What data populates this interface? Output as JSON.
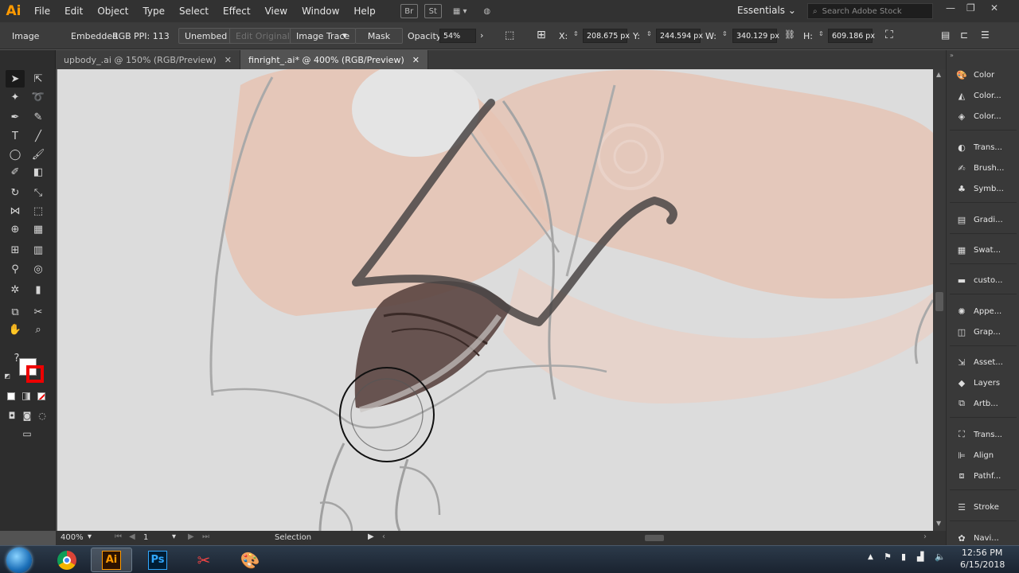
{
  "app": {
    "logo": "Ai",
    "workspace": "Essentials",
    "stock_search_placeholder": "Search Adobe Stock"
  },
  "menu": [
    "File",
    "Edit",
    "Object",
    "Type",
    "Select",
    "Effect",
    "View",
    "Window",
    "Help"
  ],
  "menubar_icons": {
    "bridge": "Br",
    "stock": "St"
  },
  "control": {
    "object_type": "Image",
    "embedded": "Embedded",
    "colormode": "RGB",
    "ppi": "PPI: 113",
    "unembed": "Unembed",
    "edit_original": "Edit Original",
    "image_trace": "Image Trace",
    "mask": "Mask",
    "opacity_label": "Opacity:",
    "opacity_value": "54%",
    "x_label": "X:",
    "x_value": "208.675 px",
    "y_label": "Y:",
    "y_value": "244.594 px",
    "w_label": "W:",
    "w_value": "340.129 px",
    "h_label": "H:",
    "h_value": "609.186 px"
  },
  "tabs": [
    {
      "label": "upbody_.ai @ 150% (RGB/Preview)",
      "active": false
    },
    {
      "label": "finright_.ai* @ 400% (RGB/Preview)",
      "active": true
    }
  ],
  "status": {
    "zoom": "400%",
    "artboard": "1",
    "tool": "Selection"
  },
  "panels": [
    "Color",
    "Color...",
    "Color...",
    "Trans...",
    "Brush...",
    "Symb...",
    "Gradi...",
    "Swat...",
    "custo...",
    "Appe...",
    "Grap...",
    "Asset...",
    "Layers",
    "Artb...",
    "Trans...",
    "Align",
    "Pathf...",
    "Stroke",
    "Navi..."
  ],
  "taskbar": {
    "time": "12:56 PM",
    "date": "6/15/2018",
    "ai_label": "Ai",
    "ps_label": "Ps"
  },
  "colors": {
    "accent_ai": "#ff9a00",
    "ps_blue": "#31a8ff",
    "canvas_bg": "#dcdcdc",
    "skin": "#e6c3b3",
    "shadow": "#5a4440"
  }
}
